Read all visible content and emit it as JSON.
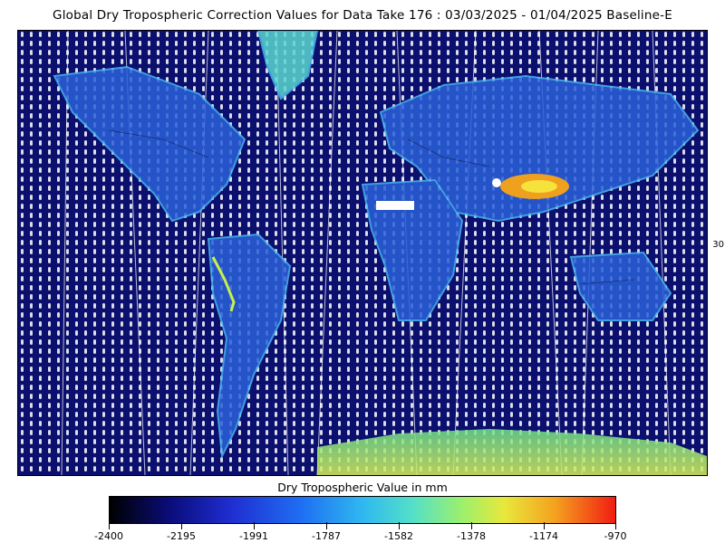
{
  "title": "Global Dry Tropospheric Correction Values for Data Take 176 : 03/03/2025 - 01/04/2025 Baseline-E",
  "colorbar": {
    "label": "Dry Tropospheric Value in mm",
    "ticks": [
      "-2400",
      "-2195",
      "-1991",
      "-1787",
      "-1582",
      "-1378",
      "-1174",
      "-970"
    ],
    "range": [
      -2400,
      -970
    ],
    "colors": [
      "#000000",
      "#0a0d7a",
      "#1f2ed1",
      "#1f6ff2",
      "#2fb8f0",
      "#54e0c8",
      "#9ff06a",
      "#e7e83b",
      "#f5a21f",
      "#f01d12"
    ]
  },
  "map": {
    "projection": "equirectangular world map",
    "ocean_color": "#0b0f6e",
    "track_color": "#ffffff",
    "edge_label": "30"
  }
}
